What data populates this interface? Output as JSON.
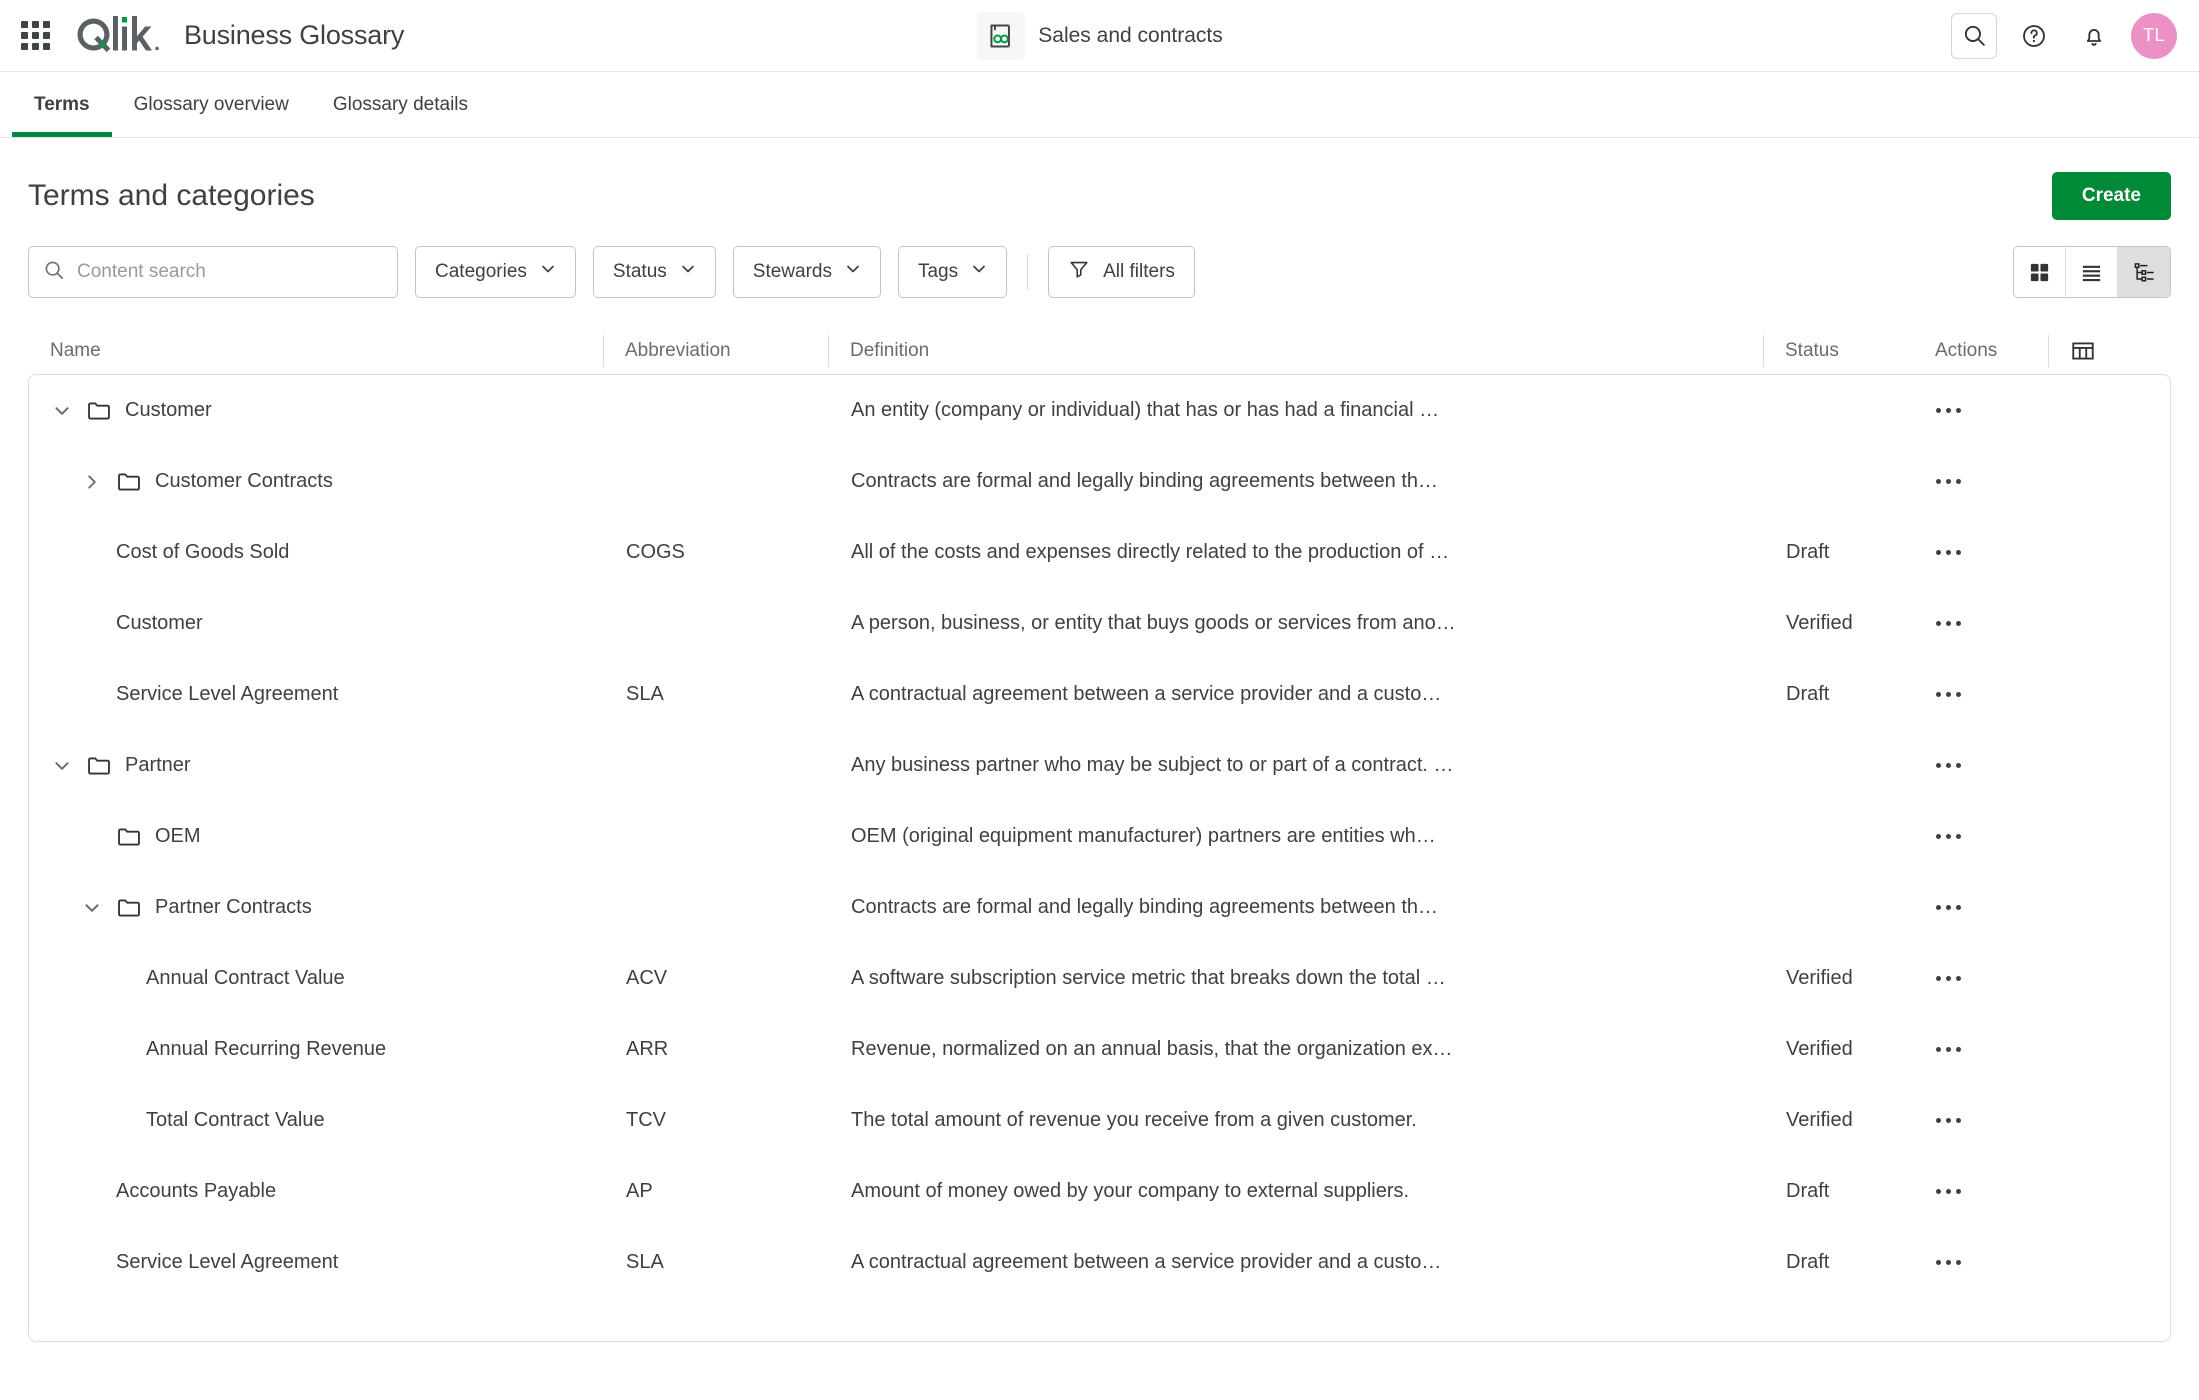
{
  "header": {
    "app_title": "Business Glossary",
    "space_name": "Sales and contracts",
    "avatar_initials": "TL",
    "icons": {
      "waffle": "apps-grid-icon",
      "logo": "qlik-logo",
      "space": "glossary-book-icon",
      "search": "search-icon",
      "help": "help-circle-icon",
      "notifications": "bell-icon"
    }
  },
  "tabs": [
    {
      "label": "Terms",
      "active": true
    },
    {
      "label": "Glossary overview",
      "active": false
    },
    {
      "label": "Glossary details",
      "active": false
    }
  ],
  "page": {
    "title": "Terms and categories",
    "create_label": "Create"
  },
  "toolbar": {
    "search_placeholder": "Content search",
    "search_value": "",
    "filters": [
      {
        "label": "Categories"
      },
      {
        "label": "Status"
      },
      {
        "label": "Stewards"
      },
      {
        "label": "Tags"
      }
    ],
    "all_filters_label": "All filters",
    "views": [
      {
        "name": "grid-view",
        "active": false
      },
      {
        "name": "list-view",
        "active": false
      },
      {
        "name": "tree-view",
        "active": true
      }
    ]
  },
  "table": {
    "columns": {
      "name": "Name",
      "abbreviation": "Abbreviation",
      "definition": "Definition",
      "status": "Status",
      "actions": "Actions"
    },
    "rows": [
      {
        "name": "Customer",
        "abbreviation": "",
        "definition": "An entity (company or individual) that has or has had a financial …",
        "status": "",
        "type": "folder",
        "indent": 1,
        "expanded": true,
        "has_children": true
      },
      {
        "name": "Customer Contracts",
        "abbreviation": "",
        "definition": "Contracts are formal and legally binding agreements between th…",
        "status": "",
        "type": "folder",
        "indent": 2,
        "expanded": false,
        "has_children": true
      },
      {
        "name": "Cost of Goods Sold",
        "abbreviation": "COGS",
        "definition": "All of the costs and expenses directly related to the production of …",
        "status": "Draft",
        "type": "term",
        "indent": 2,
        "expanded": false,
        "has_children": false
      },
      {
        "name": "Customer",
        "abbreviation": "",
        "definition": "A person, business, or entity that buys goods or services from ano…",
        "status": "Verified",
        "type": "term",
        "indent": 2,
        "expanded": false,
        "has_children": false
      },
      {
        "name": "Service Level Agreement",
        "abbreviation": "SLA",
        "definition": "A contractual agreement between a service provider and a custo…",
        "status": "Draft",
        "type": "term",
        "indent": 2,
        "expanded": false,
        "has_children": false
      },
      {
        "name": "Partner",
        "abbreviation": "",
        "definition": "Any business partner who may be subject to or part of a contract. …",
        "status": "",
        "type": "folder",
        "indent": 1,
        "expanded": true,
        "has_children": true
      },
      {
        "name": "OEM",
        "abbreviation": "",
        "definition": "OEM (original equipment manufacturer) partners are entities wh…",
        "status": "",
        "type": "folder",
        "indent": 2,
        "expanded": false,
        "has_children": false
      },
      {
        "name": "Partner Contracts",
        "abbreviation": "",
        "definition": "Contracts are formal and legally binding agreements between th…",
        "status": "",
        "type": "folder",
        "indent": 2,
        "expanded": true,
        "has_children": true
      },
      {
        "name": "Annual Contract Value",
        "abbreviation": "ACV",
        "definition": "A software subscription service metric that breaks down the total …",
        "status": "Verified",
        "type": "term",
        "indent": 3,
        "expanded": false,
        "has_children": false
      },
      {
        "name": "Annual Recurring Revenue",
        "abbreviation": "ARR",
        "definition": "Revenue, normalized on an annual basis, that the organization ex…",
        "status": "Verified",
        "type": "term",
        "indent": 3,
        "expanded": false,
        "has_children": false
      },
      {
        "name": "Total Contract Value",
        "abbreviation": "TCV",
        "definition": "The total amount of revenue you receive from a given customer.",
        "status": "Verified",
        "type": "term",
        "indent": 3,
        "expanded": false,
        "has_children": false
      },
      {
        "name": "Accounts Payable",
        "abbreviation": "AP",
        "definition": "Amount of money owed by your company to external suppliers.",
        "status": "Draft",
        "type": "term",
        "indent": 2,
        "expanded": false,
        "has_children": false
      },
      {
        "name": "Service Level Agreement",
        "abbreviation": "SLA",
        "definition": "A contractual agreement between a service provider and a custo…",
        "status": "Draft",
        "type": "term",
        "indent": 2,
        "expanded": false,
        "has_children": false
      }
    ]
  },
  "colors": {
    "brand_green": "#008936",
    "tab_underline": "#00873d",
    "avatar_pink": "#eb91c6",
    "border": "#dcdcdc",
    "text": "#404040"
  }
}
